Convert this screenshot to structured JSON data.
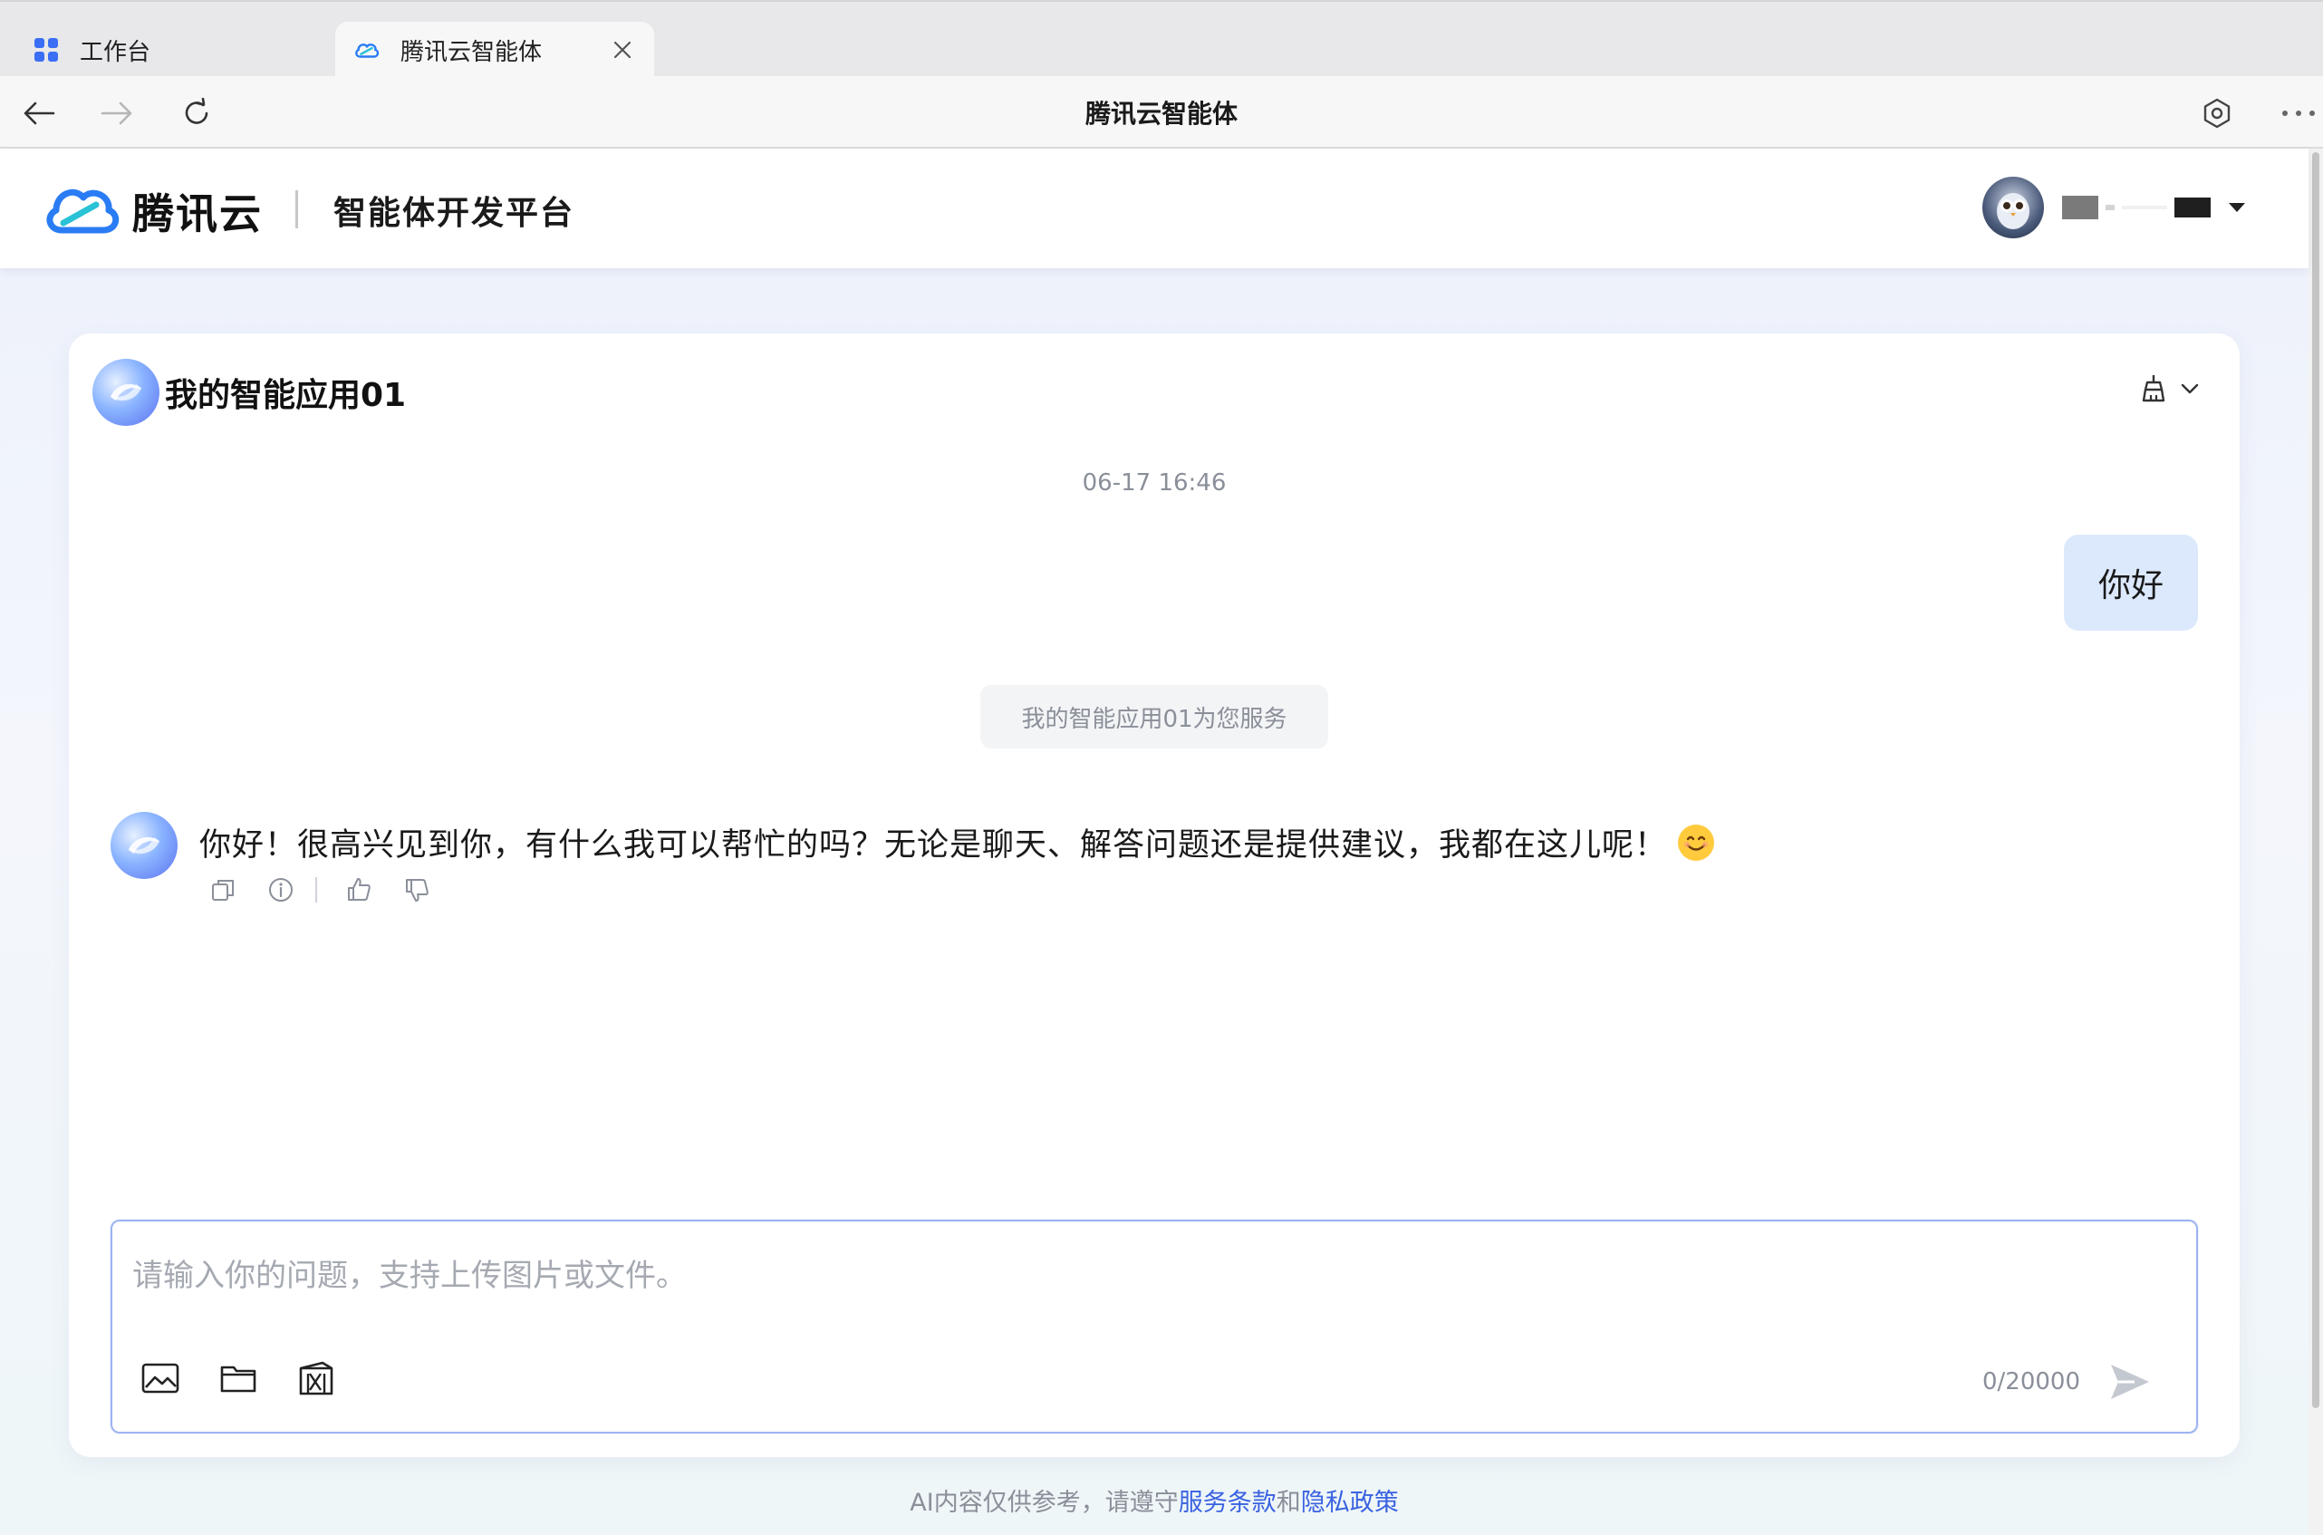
{
  "browser": {
    "tabs": [
      {
        "label": "工作台",
        "active": false
      },
      {
        "label": "腾讯云智能体",
        "active": true
      }
    ],
    "page_title": "腾讯云智能体"
  },
  "header": {
    "brand": "腾讯云",
    "platform": "智能体开发平台"
  },
  "chat": {
    "app_name": "我的智能应用01",
    "timestamp": "06-17 16:46",
    "user_message": "你好",
    "service_notice": "我的智能应用01为您服务",
    "bot_message": "你好！很高兴见到你，有什么我可以帮忙的吗？无论是聊天、解答问题还是提供建议，我都在这儿呢！"
  },
  "input": {
    "placeholder": "请输入你的问题，支持上传图片或文件。",
    "value": "",
    "char_count": "0/20000"
  },
  "footer": {
    "text_before": "AI内容仅供参考，请遵守",
    "terms_link": "服务条款",
    "and": "和",
    "privacy_link": "隐私政策"
  },
  "colors": {
    "accent": "#3a62e0",
    "user_bubble": "#dce9fc",
    "brand_blue": "#2a7cf4"
  }
}
